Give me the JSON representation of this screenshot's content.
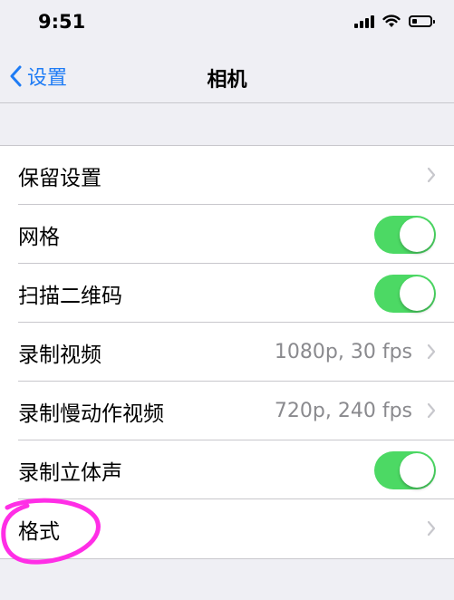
{
  "status_bar": {
    "time": "9:51",
    "battery_level": 0.2
  },
  "nav": {
    "back_label": "设置",
    "title": "相机"
  },
  "rows": [
    {
      "label": "保留设置",
      "value": "",
      "control": "chevron"
    },
    {
      "label": "网格",
      "value": "",
      "control": "toggle",
      "on": true
    },
    {
      "label": "扫描二维码",
      "value": "",
      "control": "toggle",
      "on": true
    },
    {
      "label": "录制视频",
      "value": "1080p, 30 fps",
      "control": "chevron"
    },
    {
      "label": "录制慢动作视频",
      "value": "720p, 240 fps",
      "control": "chevron"
    },
    {
      "label": "录制立体声",
      "value": "",
      "control": "toggle",
      "on": true
    },
    {
      "label": "格式",
      "value": "",
      "control": "chevron"
    }
  ],
  "colors": {
    "accent": "#1f7cf5",
    "toggle_on": "#4cd964",
    "annotation": "#ff2ee6"
  }
}
